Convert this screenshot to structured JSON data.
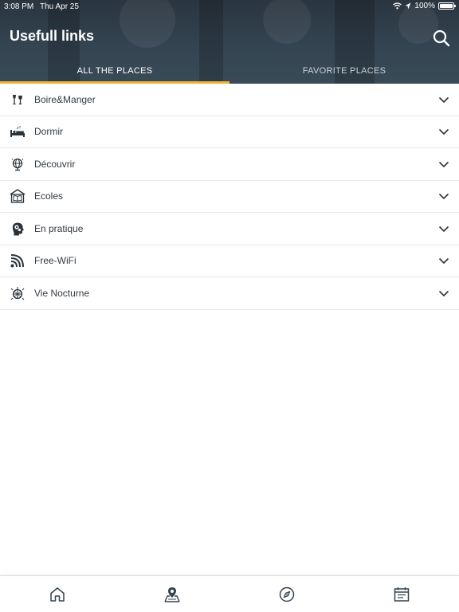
{
  "status_bar": {
    "time": "3:08 PM",
    "date": "Thu Apr 25",
    "battery": "100%"
  },
  "header": {
    "title": "Usefull links"
  },
  "tabs": [
    {
      "label": "ALL THE PLACES",
      "active": true
    },
    {
      "label": "FAVORITE PLACES",
      "active": false
    }
  ],
  "categories": [
    {
      "label": "Boire&Manger",
      "icon": "glasses-icon"
    },
    {
      "label": "Dormir",
      "icon": "bed-icon"
    },
    {
      "label": "Découvrir",
      "icon": "globe-icon"
    },
    {
      "label": "Ecoles",
      "icon": "book-house-icon"
    },
    {
      "label": "En pratique",
      "icon": "head-gears-icon"
    },
    {
      "label": "Free-WiFi",
      "icon": "wifi-icon"
    },
    {
      "label": "Vie Nocturne",
      "icon": "disco-ball-icon"
    }
  ],
  "bottom_nav": [
    {
      "name": "home",
      "icon": "home-icon"
    },
    {
      "name": "map",
      "icon": "map-pin-icon"
    },
    {
      "name": "explore",
      "icon": "compass-icon"
    },
    {
      "name": "calendar",
      "icon": "calendar-icon"
    }
  ],
  "colors": {
    "header": "#344451",
    "tab_indicator": "#f0b23a",
    "text": "#333a40"
  }
}
